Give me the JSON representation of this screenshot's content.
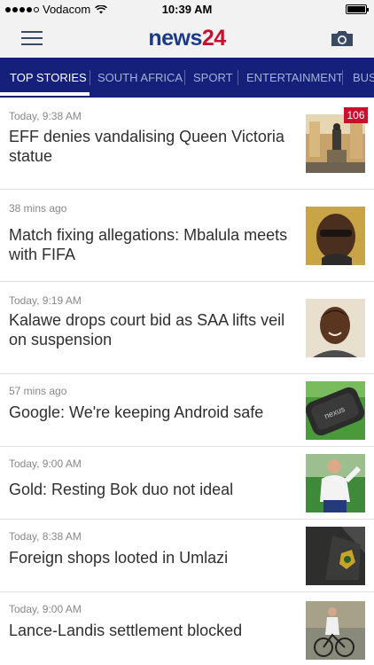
{
  "status_bar": {
    "carrier": "Vodacom",
    "time": "10:39 AM"
  },
  "header": {
    "logo_part1": "news",
    "logo_part2": "24"
  },
  "tabs": [
    "TOP STORIES",
    "SOUTH AFRICA",
    "SPORT",
    "ENTERTAINMENT",
    "BUS"
  ],
  "stories": [
    {
      "time": "Today, 9:38 AM",
      "title": "EFF denies vandalising Queen Victoria statue",
      "comments": "106"
    },
    {
      "time": "38 mins ago",
      "title": "Match fixing allegations: Mbalula meets with FIFA"
    },
    {
      "time": "Today, 9:19 AM",
      "title": "Kalawe drops court bid as SAA lifts veil on suspension"
    },
    {
      "time": "57 mins ago",
      "title": "Google: We're keeping Android safe"
    },
    {
      "time": "Today, 9:00 AM",
      "title": "Gold: Resting Bok duo not ideal"
    },
    {
      "time": "Today, 8:38 AM",
      "title": "Foreign shops looted in Umlazi"
    },
    {
      "time": "Today, 9:00 AM",
      "title": "Lance-Landis settlement blocked"
    }
  ],
  "colors": {
    "tab_bar": "#14207a",
    "badge": "#c8102e",
    "logo_blue": "#1a3a8a",
    "logo_red": "#c8102e"
  }
}
